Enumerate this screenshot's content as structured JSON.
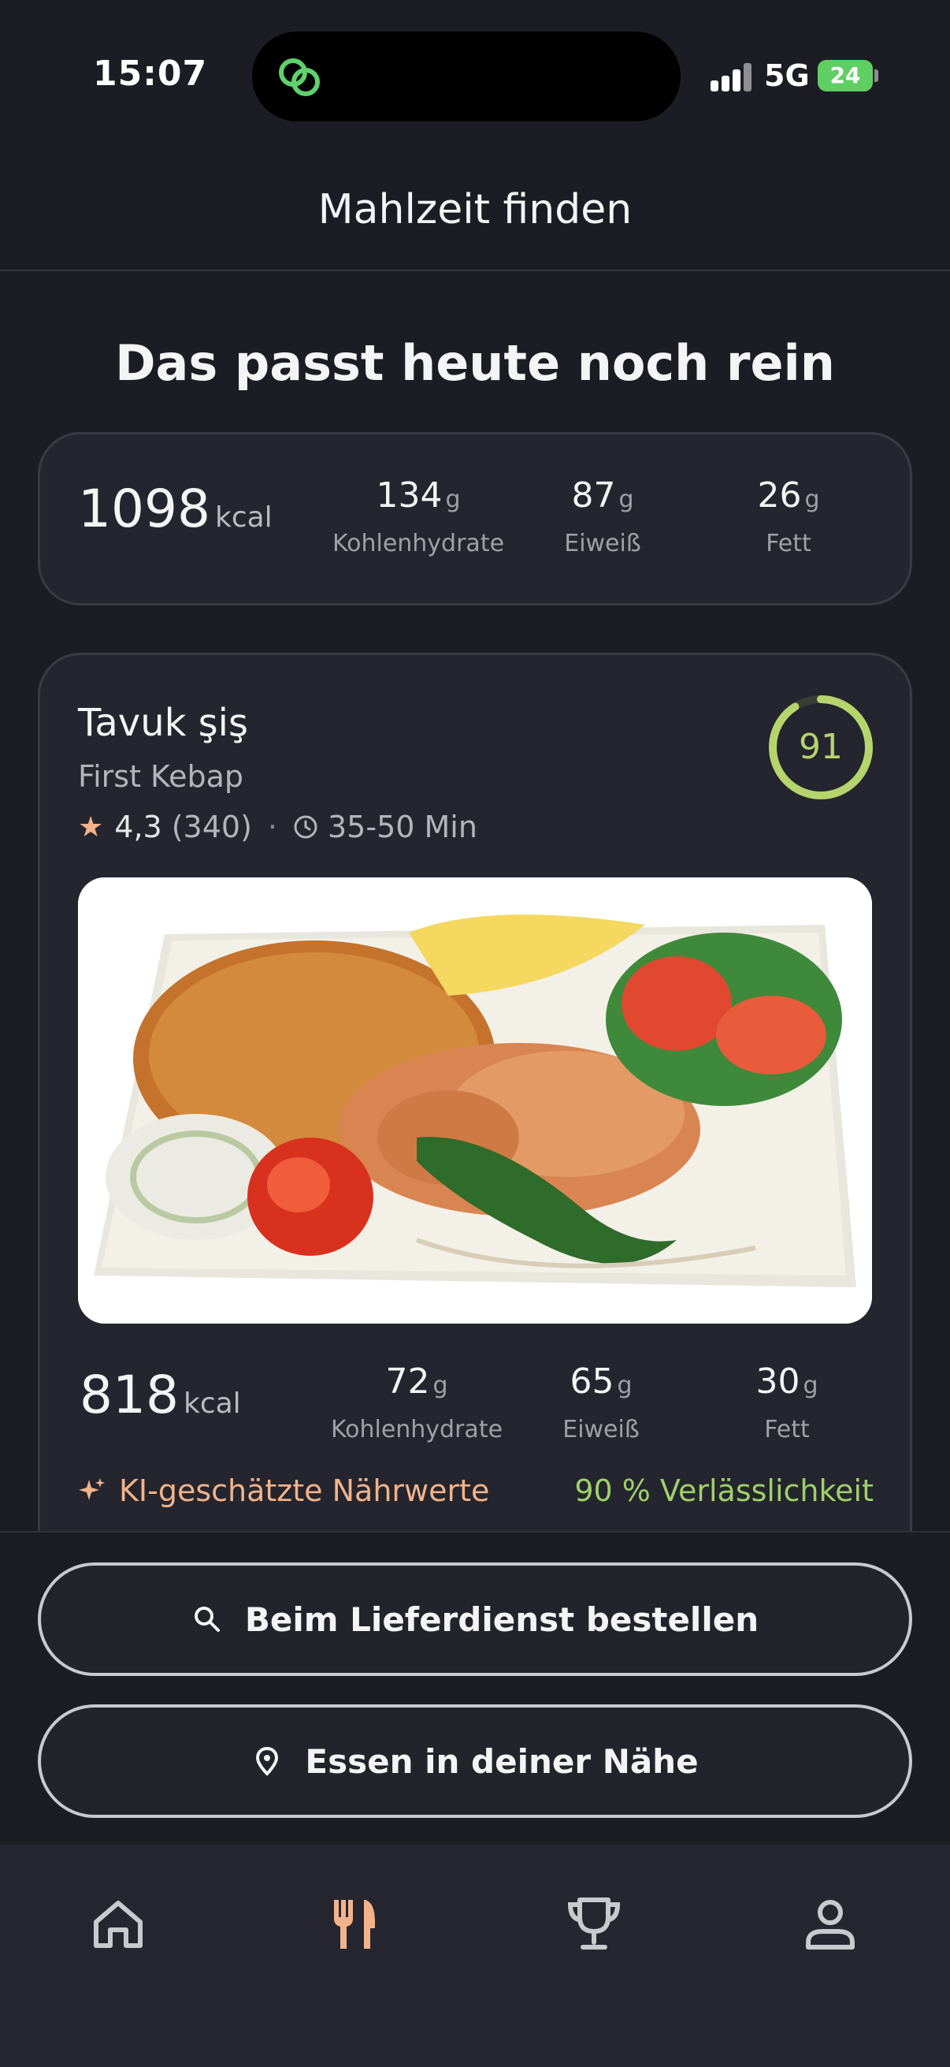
{
  "status_bar": {
    "time": "15:07",
    "network": "5G",
    "battery": "24"
  },
  "header": {
    "title": "Mahlzeit finden"
  },
  "remaining": {
    "title": "Das passt heute noch rein",
    "kcal": "1098",
    "kcal_unit": "kcal",
    "macros": [
      {
        "value": "134",
        "unit": "g",
        "label": "Kohlenhydrate"
      },
      {
        "value": "87",
        "unit": "g",
        "label": "Eiweiß"
      },
      {
        "value": "26",
        "unit": "g",
        "label": "Fett"
      }
    ]
  },
  "meal": {
    "name": "Tavuk şiş",
    "restaurant": "First Kebap",
    "rating": "4,3",
    "reviews": "(340)",
    "separator": "·",
    "delivery_time": "35-50 Min",
    "score": "91",
    "score_fraction": 0.91,
    "kcal": "818",
    "kcal_unit": "kcal",
    "macros": [
      {
        "value": "72",
        "unit": "g",
        "label": "Kohlenhydrate"
      },
      {
        "value": "65",
        "unit": "g",
        "label": "Eiweiß"
      },
      {
        "value": "30",
        "unit": "g",
        "label": "Fett"
      }
    ],
    "ai_label": "KI-geschätzte Nährwerte",
    "reliability": "90 % Verlässlichkeit"
  },
  "actions": {
    "delivery": "Beim Lieferdienst bestellen",
    "nearby": "Essen in deiner Nähe"
  },
  "tabs": [
    {
      "icon": "home-icon",
      "active": false
    },
    {
      "icon": "fork-knife-icon",
      "active": true
    },
    {
      "icon": "trophy-icon",
      "active": false
    },
    {
      "icon": "profile-icon",
      "active": false
    }
  ],
  "colors": {
    "accent": "#f2b38a",
    "score_green": "#b5d46c",
    "reliability_green": "#9fd06b",
    "background": "#1c1d24",
    "card": "#24252e"
  }
}
